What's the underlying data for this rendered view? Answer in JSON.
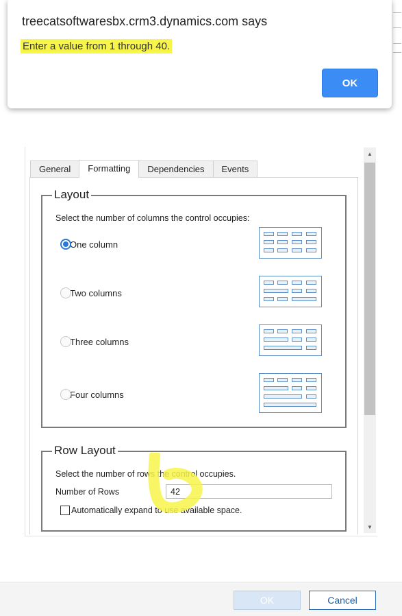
{
  "alert": {
    "title": "treecatsoftwaresbx.crm3.dynamics.com says",
    "message": "Enter a value from 1 through 40.",
    "ok_label": "OK",
    "button_color": "#3b8cf5",
    "highlight_color": "#f7f54a"
  },
  "tabs": [
    {
      "label": "General",
      "active": false
    },
    {
      "label": "Formatting",
      "active": true
    },
    {
      "label": "Dependencies",
      "active": false
    },
    {
      "label": "Events",
      "active": false
    }
  ],
  "layout": {
    "legend": "Layout",
    "description": "Select the number of columns the control occupies:",
    "options": [
      {
        "label": "One column",
        "checked": true
      },
      {
        "label": "Two columns",
        "checked": false
      },
      {
        "label": "Three columns",
        "checked": false
      },
      {
        "label": "Four columns",
        "checked": false
      }
    ]
  },
  "row_layout": {
    "legend": "Row Layout",
    "description": "Select the number of rows the control occupies.",
    "rows_label": "Number of Rows",
    "rows_value": "42",
    "auto_expand_label": "Automatically expand to use available space.",
    "auto_expand_checked": false
  },
  "footer": {
    "ok_label": "OK",
    "cancel_label": "Cancel"
  }
}
